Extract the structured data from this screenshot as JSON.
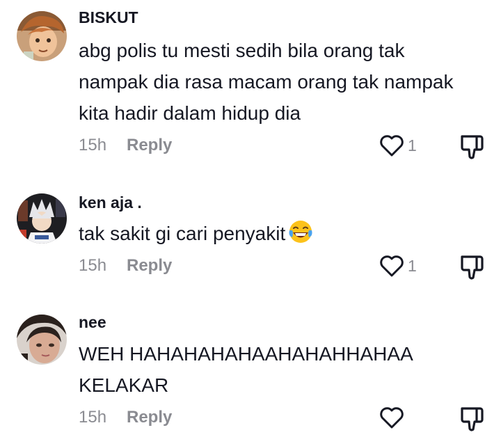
{
  "comments": [
    {
      "username": "BISKUT",
      "text": "abg polis tu mesti sedih bila orang tak nampak dia rasa macam orang tak nampak kita hadir dalam hidup dia",
      "time": "15h",
      "reply_label": "Reply",
      "like_count": "1",
      "avatar_icon": "animated-character-avatar"
    },
    {
      "username": "ken aja .",
      "text": "tak sakit gi cari penyakit",
      "emoji": "face-with-tears-of-joy-emoji",
      "time": "15h",
      "reply_label": "Reply",
      "like_count": "1",
      "avatar_icon": "anime-character-avatar"
    },
    {
      "username": "nee",
      "text": "WEH HAHAHAHAHAAHAHAHHAHAA KELAKAR",
      "time": "15h",
      "reply_label": "Reply",
      "like_count": "",
      "avatar_icon": "person-photo-avatar"
    }
  ],
  "colors": {
    "text_primary": "#161823",
    "text_secondary": "#8a8b91",
    "icon": "#161823"
  }
}
